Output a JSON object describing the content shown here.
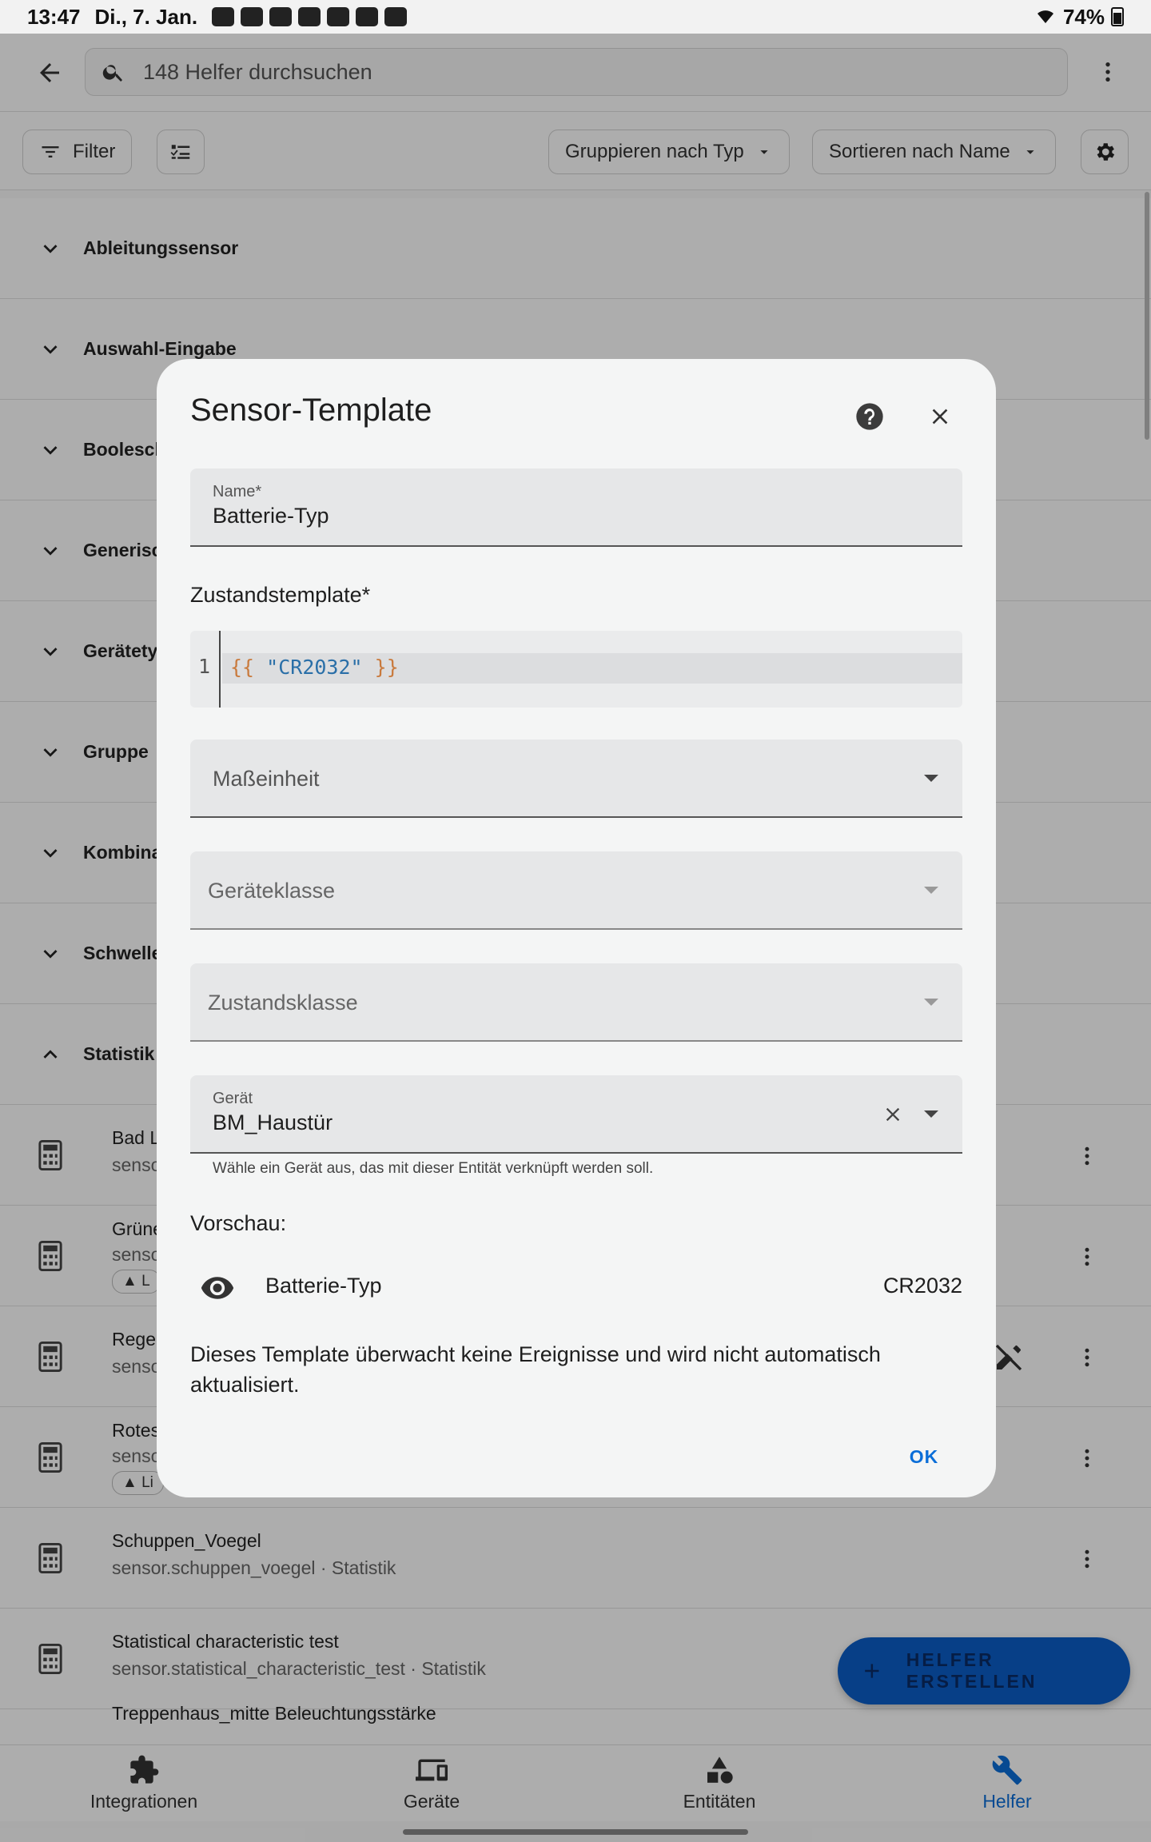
{
  "status_bar": {
    "time": "13:47",
    "date": "Di., 7. Jan.",
    "battery": "74%"
  },
  "topbar": {
    "search_placeholder": "148 Helfer durchsuchen"
  },
  "toolbar": {
    "filter_label": "Filter",
    "group_by_label": "Gruppieren nach Typ",
    "sort_by_label": "Sortieren nach Name"
  },
  "groups": [
    {
      "label": "Ableitungssensor"
    },
    {
      "label": "Auswahl-Eingabe"
    },
    {
      "label": "Booleschi"
    },
    {
      "label": "Generisc"
    },
    {
      "label": "Gerätety"
    },
    {
      "label": "Gruppe"
    },
    {
      "label": "Kombina"
    },
    {
      "label": "Schwelle"
    },
    {
      "label": "Statistik"
    }
  ],
  "items": [
    {
      "title": "Bad L",
      "subtitle": "senso"
    },
    {
      "title": "Grüne",
      "subtitle": "senso",
      "tag": "L"
    },
    {
      "title": "Rege",
      "subtitle": "senso"
    },
    {
      "title": "Rotes",
      "subtitle": "senso",
      "tag": "Li"
    },
    {
      "title": "Schuppen_Voegel",
      "subtitle": "sensor.schuppen_voegel · Statistik"
    },
    {
      "title": "Statistical characteristic test",
      "subtitle": "sensor.statistical_characteristic_test · Statistik"
    },
    {
      "title": "Treppenhaus_mitte Beleuchtungsstärke",
      "subtitle": ""
    }
  ],
  "fab": {
    "label": "HELFER ERSTELLEN"
  },
  "bottom_nav": [
    {
      "label": "Integrationen",
      "icon": "puzzle-icon"
    },
    {
      "label": "Geräte",
      "icon": "devices-icon"
    },
    {
      "label": "Entitäten",
      "icon": "shapes-icon"
    },
    {
      "label": "Helfer",
      "icon": "tools-icon",
      "active": true
    }
  ],
  "dialog": {
    "title": "Sensor-Template",
    "name_field": {
      "label": "Name*",
      "value": "Batterie-Typ"
    },
    "state_template_label": "Zustandstemplate*",
    "code": {
      "line_number": "1",
      "open": "{{",
      "string": "\"CR2032\"",
      "close": "}}"
    },
    "unit_field": {
      "placeholder": "Maßeinheit"
    },
    "device_class_field": {
      "placeholder": "Geräteklasse"
    },
    "state_class_field": {
      "placeholder": "Zustandsklasse"
    },
    "device_field": {
      "label": "Gerät",
      "value": "BM_Haustür",
      "helper": "Wähle ein Gerät aus, das mit dieser Entität verknüpft werden soll."
    },
    "preview_label": "Vorschau:",
    "preview": {
      "name": "Batterie-Typ",
      "value": "CR2032"
    },
    "info": "Dieses Template überwacht keine Ereignisse und wird nicht automatisch aktualisiert.",
    "ok_label": "OK"
  },
  "colors": {
    "accent": "#0b6ed8",
    "fab": "#0b5ec8",
    "scrim": "rgba(0,0,0,0.32)"
  }
}
